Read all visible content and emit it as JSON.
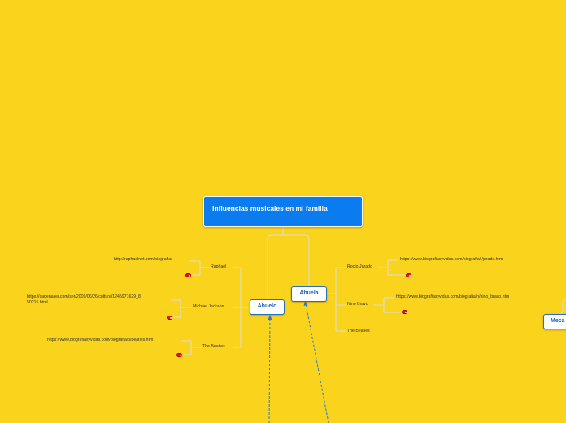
{
  "root": {
    "title": "Influencias musicales en mi familia"
  },
  "abuelo": {
    "label": "Abuelo",
    "children": [
      {
        "label": "Raphael",
        "link": "http://raphaelnet.com/biografia/"
      },
      {
        "label": "Michael Jackson",
        "link": "https://cadenaser.com/ser/2009/06/26/cultura/1245971629_8",
        "link2": "50215.html"
      },
      {
        "label": "The Beatles",
        "link": "https://www.biografiasyvidas.com/biografia/b/beatles.htm"
      }
    ]
  },
  "abuela": {
    "label": "Abuela",
    "children": [
      {
        "label": "Rocío Jurado",
        "link": "https://www.biografiasyvidas.com/biografia/j/jurado.htm"
      },
      {
        "label": "Nino Bravo",
        "link": "https://www.biografiasyvidas.com/biografia/n/nino_bravo.htm"
      },
      {
        "label": "The Beatles"
      }
    ]
  },
  "third": {
    "label": "Meca"
  },
  "colors": {
    "background": "#f9d31c",
    "root": "#0a7cf0",
    "node_border": "#2a6fb5",
    "badge": "#e8101a",
    "connector": "#d9d9d9",
    "dashed": "#2e7ac8"
  }
}
